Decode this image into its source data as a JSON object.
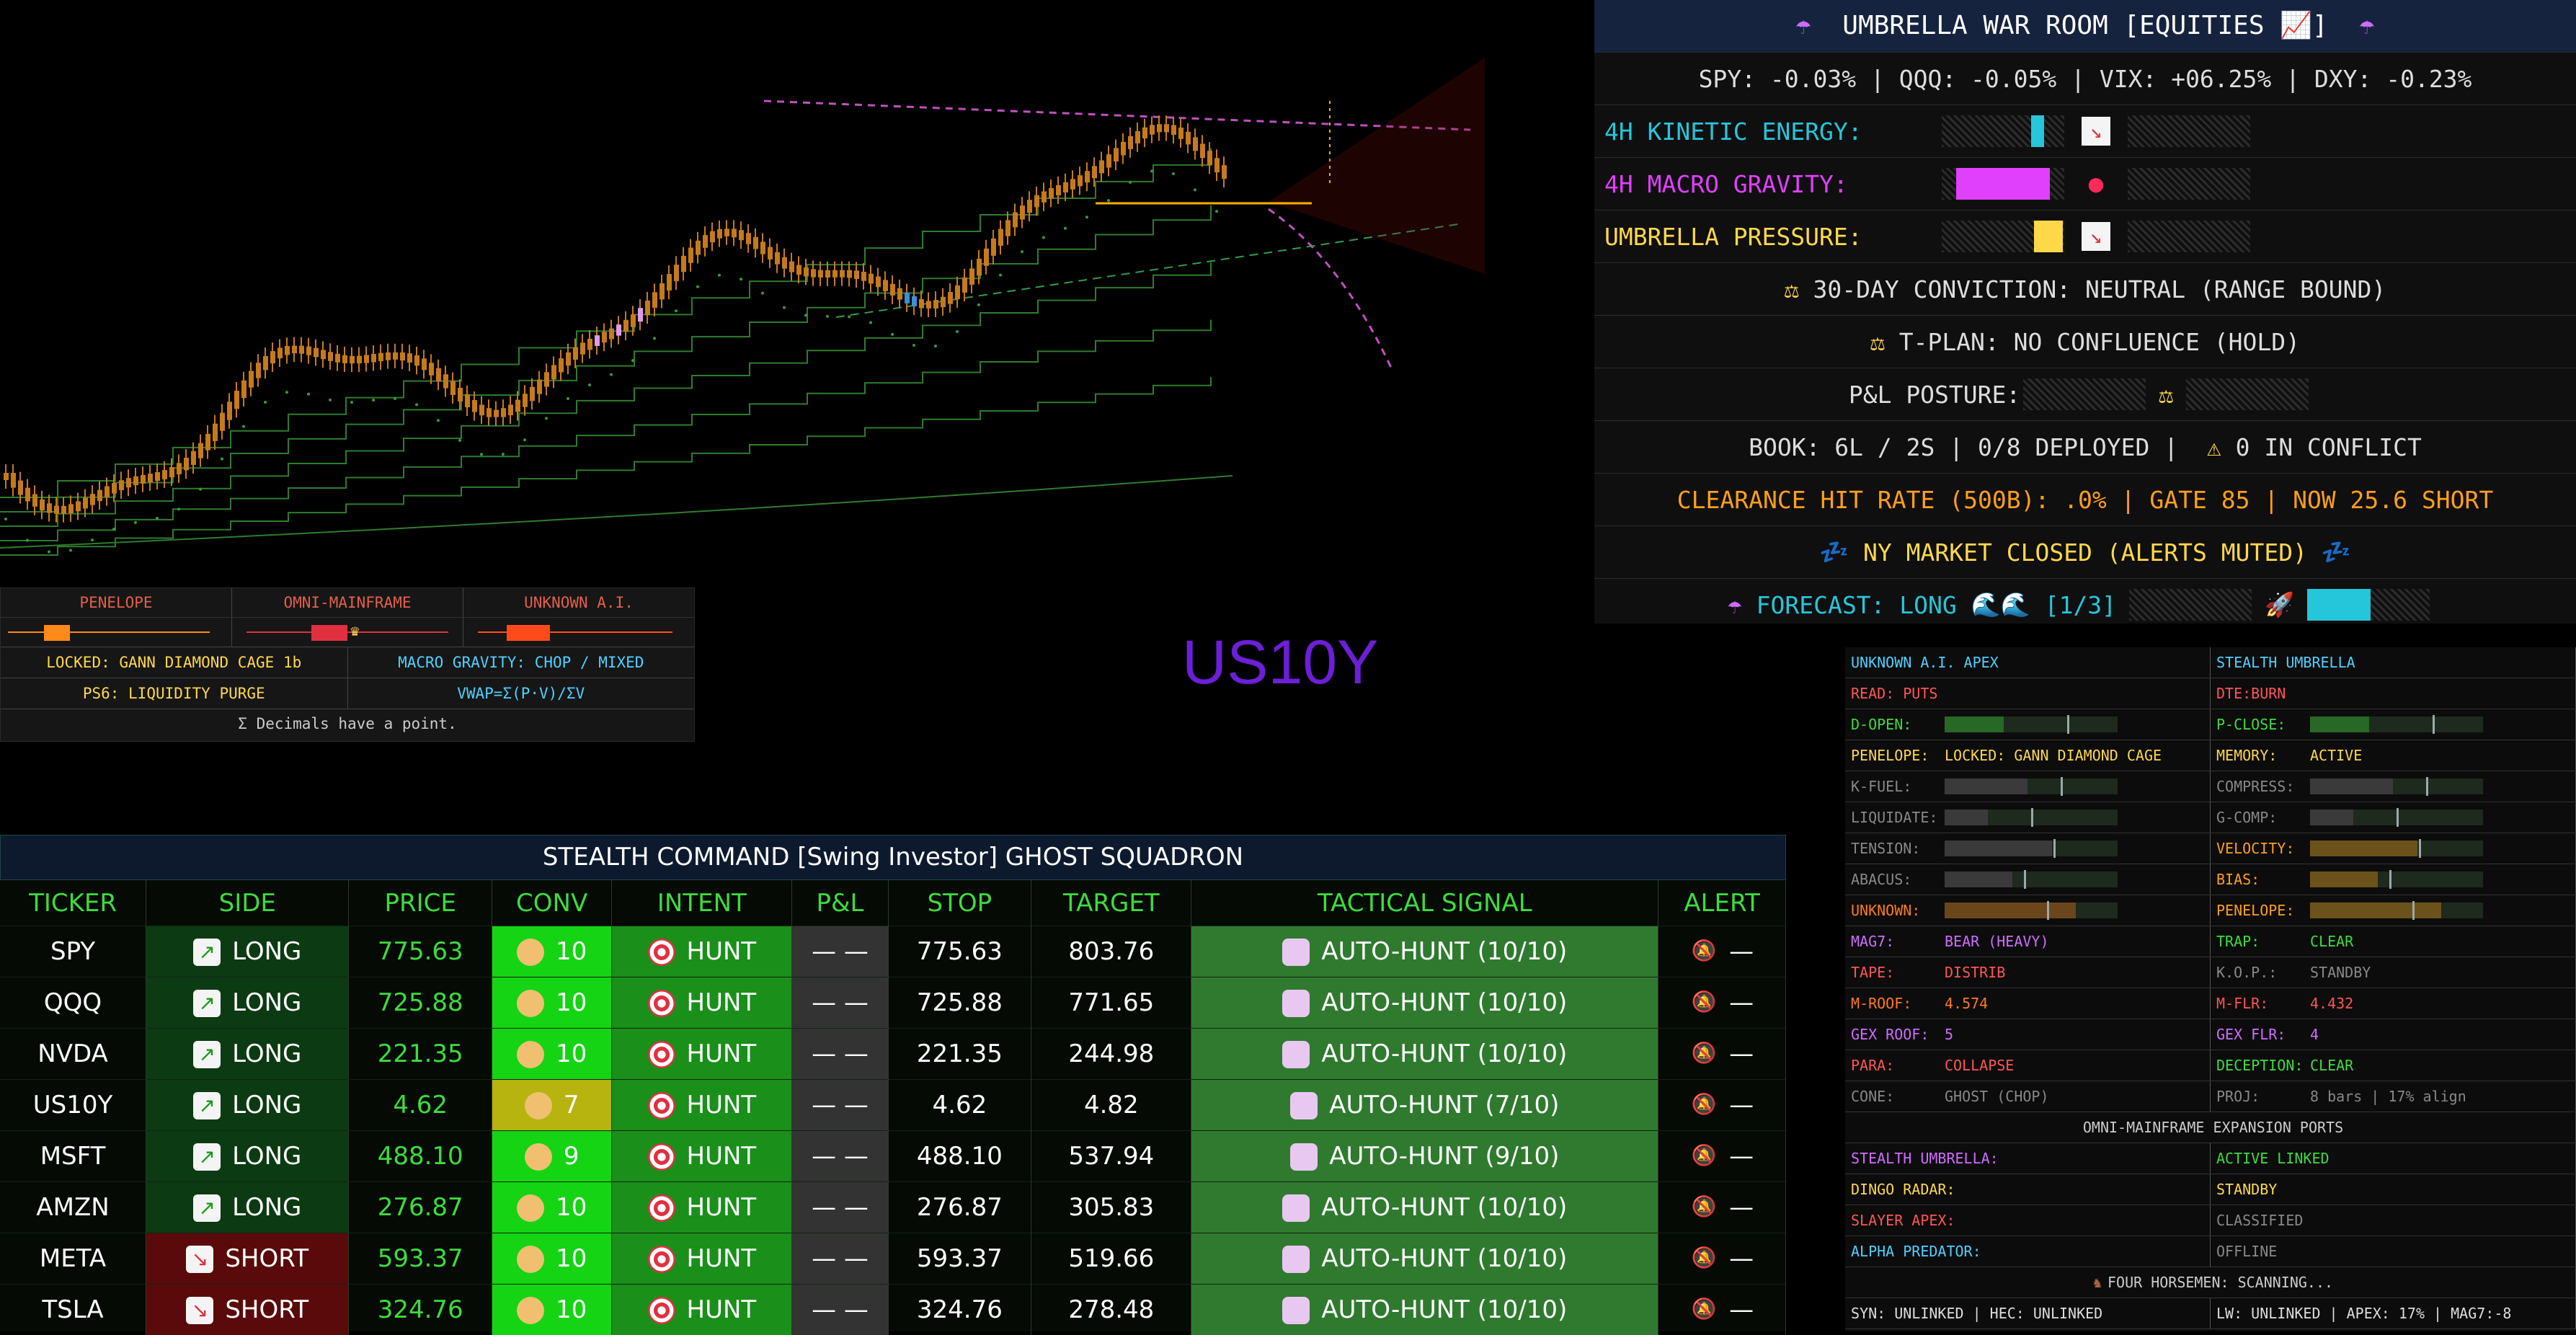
{
  "colors": {
    "long": "#0c3a12",
    "short": "#5a0a0a",
    "conv_hi": "#14d414",
    "conv_mid": "#b7b410",
    "hunt": "#1a8f1a",
    "signal": "#2f7a2f",
    "pl": "#333333"
  },
  "chart": {
    "symbol": "US10Y"
  },
  "mini": {
    "headers": [
      "PENELOPE",
      "OMNI-MAINFRAME",
      "UNKNOWN A.I."
    ],
    "row1": [
      "LOCKED: GANN DIAMOND CAGE 1b",
      "MACRO GRAVITY: CHOP / MIXED"
    ],
    "row2": [
      "PS6: LIQUIDITY PURGE",
      "VWAP=Σ(P·V)/ΣV"
    ],
    "foot": "Σ Decimals have a point."
  },
  "war": {
    "title": "UMBRELLA WAR ROOM [EQUITIES",
    "ticker": "SPY: -0.03% | QQQ: -0.05% | VIX: +06.25% | DXY: -0.23%",
    "kinetic": "4H KINETIC ENERGY:",
    "macro": "4H MACRO GRAVITY:",
    "pressure": "UMBRELLA PRESSURE:",
    "conviction": "30-DAY CONVICTION: NEUTRAL (RANGE BOUND)",
    "tplan": "T-PLAN: NO CONFLUENCE (HOLD)",
    "posture": "P&L POSTURE:",
    "book": "BOOK: 6L / 2S  |  0/8 DEPLOYED  |",
    "conflict": "0 IN CONFLICT",
    "clearance": "CLEARANCE HIT RATE (500B): .0%  |  GATE 85  |  NOW 25.6 SHORT",
    "market": "NY MARKET CLOSED (ALERTS MUTED)",
    "forecast": "FORECAST: LONG",
    "forecast_count": "[1/3]"
  },
  "stealth": {
    "left": [
      {
        "k": "UNKNOWN A.I. APEX",
        "v": "",
        "c": "#4fd0ff"
      },
      {
        "k": "READ: PUTS",
        "v": "",
        "c": "#ff5555"
      },
      {
        "k": "D-OPEN:",
        "v": "",
        "c": "#3ddc3d"
      },
      {
        "k": "PENELOPE:",
        "v": "LOCKED: GANN DIAMOND CAGE",
        "c": "#ffd84a"
      },
      {
        "k": "K-FUEL:",
        "v": "",
        "c": "#888"
      },
      {
        "k": "LIQUIDATE:",
        "v": "",
        "c": "#888"
      },
      {
        "k": "TENSION:",
        "v": "",
        "c": "#888"
      },
      {
        "k": "ABACUS:",
        "v": "",
        "c": "#888"
      },
      {
        "k": "UNKNOWN:",
        "v": "",
        "c": "#ff7a1a"
      },
      {
        "k": "MAG7:",
        "v": "BEAR (HEAVY)",
        "c": "#cf6cff"
      },
      {
        "k": "TAPE:",
        "v": "DISTRIB",
        "c": "#ff5555"
      },
      {
        "k": "M-ROOF:",
        "v": "4.574",
        "c": "#ff7a1a"
      },
      {
        "k": "GEX ROOF:",
        "v": "5",
        "c": "#cf6cff"
      },
      {
        "k": "PARA:",
        "v": "COLLAPSE",
        "c": "#ff5555"
      },
      {
        "k": "CONE:",
        "v": "GHOST (CHOP)",
        "c": "#888"
      }
    ],
    "right": [
      {
        "k": "STEALTH UMBRELLA",
        "v": "",
        "c": "#4fd0ff"
      },
      {
        "k": "DTE:",
        "v": "BURN",
        "c": "#ff5555"
      },
      {
        "k": "P-CLOSE:",
        "v": "",
        "c": "#3ddc3d"
      },
      {
        "k": "MEMORY:",
        "v": "ACTIVE",
        "c": "#ffd84a"
      },
      {
        "k": "COMPRESS:",
        "v": "",
        "c": "#888"
      },
      {
        "k": "G-COMP:",
        "v": "",
        "c": "#888"
      },
      {
        "k": "VELOCITY:",
        "v": "",
        "c": "#ff9f1a"
      },
      {
        "k": "BIAS:",
        "v": "",
        "c": "#ff9f1a"
      },
      {
        "k": "PENELOPE:",
        "v": "",
        "c": "#ff9f1a"
      },
      {
        "k": "TRAP:",
        "v": "CLEAR",
        "c": "#3ddc3d"
      },
      {
        "k": "K.O.P.:",
        "v": "STANDBY",
        "c": "#888"
      },
      {
        "k": "M-FLR:",
        "v": "4.432",
        "c": "#ff5555"
      },
      {
        "k": "GEX FLR:",
        "v": "4",
        "c": "#cf6cff"
      },
      {
        "k": "DECEPTION:",
        "v": "CLEAR",
        "c": "#3ddc3d"
      },
      {
        "k": "PROJ:",
        "v": "8 bars | 17% align",
        "c": "#888"
      }
    ],
    "expansion": "OMNI-MAINFRAME EXPANSION PORTS",
    "ports": [
      {
        "k": "STEALTH UMBRELLA:",
        "v": "ACTIVE LINKED",
        "c": "#cf6cff",
        "vc": "#3ddc3d"
      },
      {
        "k": "DINGO RADAR:",
        "v": "STANDBY",
        "c": "#ffd84a",
        "vc": "#ffd84a"
      },
      {
        "k": "SLAYER APEX:",
        "v": "CLASSIFIED",
        "c": "#ff5555",
        "vc": "#888"
      },
      {
        "k": "ALPHA PREDATOR:",
        "v": "OFFLINE",
        "c": "#4fd0ff",
        "vc": "#888"
      }
    ],
    "horsemen": "FOUR HORSEMEN: SCANNING...",
    "status_left": "SYN:   UNLINKED | HEC:   UNLINKED",
    "status_right": "LW:   UNLINKED | APEX: 17% | MAG7:-8"
  },
  "command": {
    "title": "STEALTH COMMAND [Swing Investor] GHOST SQUADRON",
    "headers": [
      "TICKER",
      "SIDE",
      "PRICE",
      "CONV",
      "INTENT",
      "P&L",
      "STOP",
      "TARGET",
      "TACTICAL SIGNAL",
      "ALERT"
    ],
    "rows": [
      {
        "ticker": "SPY",
        "side": "LONG",
        "price": "775.63",
        "conv": "10",
        "intent": "HUNT",
        "pl": "— —",
        "stop": "775.63",
        "target": "803.76",
        "signal": "AUTO-HUNT (10/10)",
        "alert": "—"
      },
      {
        "ticker": "QQQ",
        "side": "LONG",
        "price": "725.88",
        "conv": "10",
        "intent": "HUNT",
        "pl": "— —",
        "stop": "725.88",
        "target": "771.65",
        "signal": "AUTO-HUNT (10/10)",
        "alert": "—"
      },
      {
        "ticker": "NVDA",
        "side": "LONG",
        "price": "221.35",
        "conv": "10",
        "intent": "HUNT",
        "pl": "— —",
        "stop": "221.35",
        "target": "244.98",
        "signal": "AUTO-HUNT (10/10)",
        "alert": "—"
      },
      {
        "ticker": "US10Y",
        "side": "LONG",
        "price": "4.62",
        "conv": "7",
        "intent": "HUNT",
        "pl": "— —",
        "stop": "4.62",
        "target": "4.82",
        "signal": "AUTO-HUNT (7/10)",
        "alert": "—"
      },
      {
        "ticker": "MSFT",
        "side": "LONG",
        "price": "488.10",
        "conv": "9",
        "intent": "HUNT",
        "pl": "— —",
        "stop": "488.10",
        "target": "537.94",
        "signal": "AUTO-HUNT (9/10)",
        "alert": "—"
      },
      {
        "ticker": "AMZN",
        "side": "LONG",
        "price": "276.87",
        "conv": "10",
        "intent": "HUNT",
        "pl": "— —",
        "stop": "276.87",
        "target": "305.83",
        "signal": "AUTO-HUNT (10/10)",
        "alert": "—"
      },
      {
        "ticker": "META",
        "side": "SHORT",
        "price": "593.37",
        "conv": "10",
        "intent": "HUNT",
        "pl": "— —",
        "stop": "593.37",
        "target": "519.66",
        "signal": "AUTO-HUNT (10/10)",
        "alert": "—"
      },
      {
        "ticker": "TSLA",
        "side": "SHORT",
        "price": "324.76",
        "conv": "10",
        "intent": "HUNT",
        "pl": "— —",
        "stop": "324.76",
        "target": "278.48",
        "signal": "AUTO-HUNT (10/10)",
        "alert": "—"
      }
    ]
  }
}
